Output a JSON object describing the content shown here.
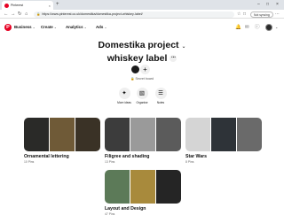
{
  "browser": {
    "tab_title": "Pinterest",
    "tab_close": "×",
    "new_tab": "+",
    "window_controls": [
      "–",
      "□",
      "×"
    ],
    "url": "https://www.pinterest.co.uk/domestika/domestika-project-whiskey-label/",
    "not_syncing_label": "Not syncing",
    "nav_icons": [
      "back-icon",
      "forward-icon",
      "reload-icon",
      "home-icon"
    ]
  },
  "header": {
    "logo_letter": "P",
    "nav": [
      {
        "label": "Business"
      },
      {
        "label": "Create"
      },
      {
        "label": "Analytics"
      },
      {
        "label": "Ads"
      }
    ],
    "icons": [
      "bell-icon",
      "chat-icon",
      "help-icon"
    ]
  },
  "board": {
    "title_line1": "Domestika project",
    "title_line2": "whiskey label",
    "visibility": "Secret board",
    "actions": [
      {
        "label": "More ideas",
        "icon": "sparkle-icon"
      },
      {
        "label": "Organise",
        "icon": "organise-icon"
      },
      {
        "label": "Notes",
        "icon": "notes-icon"
      }
    ]
  },
  "sections": [
    {
      "name": "Ornamental lettering",
      "count": "10 Pins",
      "colors": [
        "#2a2a28",
        "#6f5a37",
        "#3a3226"
      ]
    },
    {
      "name": "Filigree and shading",
      "count": "13 Pins",
      "colors": [
        "#3c3c3c",
        "#9a9a9a",
        "#5b5b5b"
      ]
    },
    {
      "name": "Star Wars",
      "count": "8 Pins",
      "colors": [
        "#d5d5d5",
        "#2e3338",
        "#6a6a6a"
      ]
    },
    {
      "name": "Layout and Design",
      "count": "47 Pins",
      "colors": [
        "#5c7a58",
        "#a88a3c",
        "#252525"
      ]
    }
  ]
}
